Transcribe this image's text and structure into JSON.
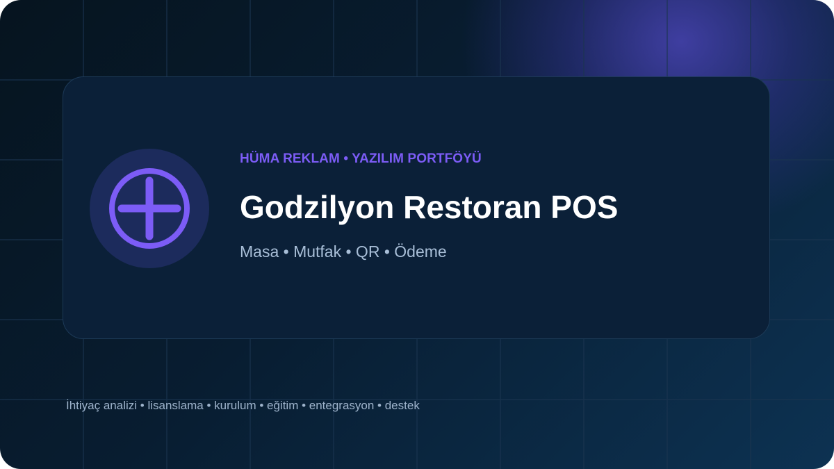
{
  "banner": {
    "kicker": "HÜMA REKLAM • YAZILIM PORTFÖYÜ",
    "title": "Godzilyon Restoran POS",
    "subtitle": "Masa • Mutfak • QR • Ödeme",
    "footer": "İhtiyaç analizi • lisanslama • kurulum • eğitim • entegrasyon • destek",
    "icon": "plus-circle-icon"
  },
  "colors": {
    "background_dark": "#06141f",
    "background_light": "#0d3252",
    "card": "#0b2038",
    "accent": "#7c5cf6",
    "icon_bg": "#1c2b5c",
    "title": "#ffffff",
    "subtitle": "#a9bfd8"
  }
}
